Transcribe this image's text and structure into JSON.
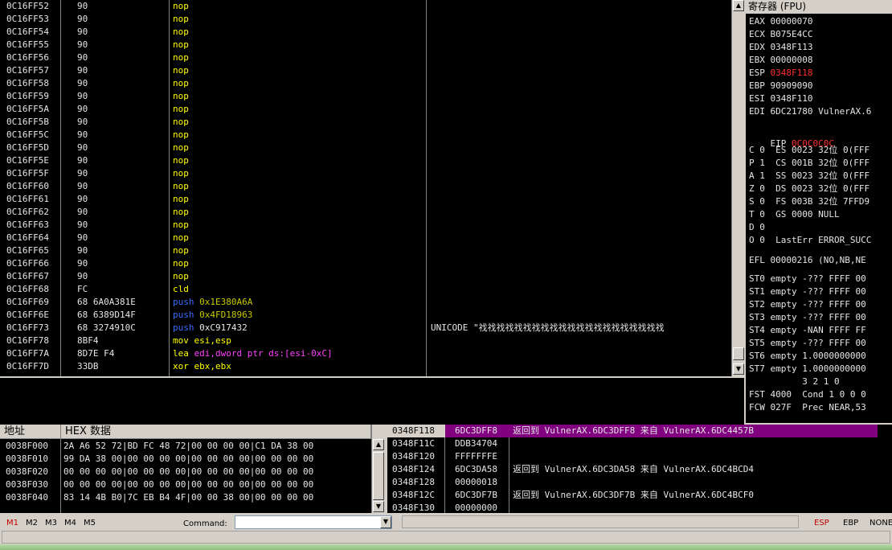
{
  "disasm": {
    "rows": [
      {
        "addr": "0C16FF52",
        "hex": "90",
        "mnem": "nop",
        "operand": "",
        "type": "nop"
      },
      {
        "addr": "0C16FF53",
        "hex": "90",
        "mnem": "nop",
        "operand": "",
        "type": "nop"
      },
      {
        "addr": "0C16FF54",
        "hex": "90",
        "mnem": "nop",
        "operand": "",
        "type": "nop"
      },
      {
        "addr": "0C16FF55",
        "hex": "90",
        "mnem": "nop",
        "operand": "",
        "type": "nop"
      },
      {
        "addr": "0C16FF56",
        "hex": "90",
        "mnem": "nop",
        "operand": "",
        "type": "nop"
      },
      {
        "addr": "0C16FF57",
        "hex": "90",
        "mnem": "nop",
        "operand": "",
        "type": "nop"
      },
      {
        "addr": "0C16FF58",
        "hex": "90",
        "mnem": "nop",
        "operand": "",
        "type": "nop"
      },
      {
        "addr": "0C16FF59",
        "hex": "90",
        "mnem": "nop",
        "operand": "",
        "type": "nop"
      },
      {
        "addr": "0C16FF5A",
        "hex": "90",
        "mnem": "nop",
        "operand": "",
        "type": "nop"
      },
      {
        "addr": "0C16FF5B",
        "hex": "90",
        "mnem": "nop",
        "operand": "",
        "type": "nop"
      },
      {
        "addr": "0C16FF5C",
        "hex": "90",
        "mnem": "nop",
        "operand": "",
        "type": "nop"
      },
      {
        "addr": "0C16FF5D",
        "hex": "90",
        "mnem": "nop",
        "operand": "",
        "type": "nop"
      },
      {
        "addr": "0C16FF5E",
        "hex": "90",
        "mnem": "nop",
        "operand": "",
        "type": "nop"
      },
      {
        "addr": "0C16FF5F",
        "hex": "90",
        "mnem": "nop",
        "operand": "",
        "type": "nop"
      },
      {
        "addr": "0C16FF60",
        "hex": "90",
        "mnem": "nop",
        "operand": "",
        "type": "nop"
      },
      {
        "addr": "0C16FF61",
        "hex": "90",
        "mnem": "nop",
        "operand": "",
        "type": "nop"
      },
      {
        "addr": "0C16FF62",
        "hex": "90",
        "mnem": "nop",
        "operand": "",
        "type": "nop"
      },
      {
        "addr": "0C16FF63",
        "hex": "90",
        "mnem": "nop",
        "operand": "",
        "type": "nop"
      },
      {
        "addr": "0C16FF64",
        "hex": "90",
        "mnem": "nop",
        "operand": "",
        "type": "nop"
      },
      {
        "addr": "0C16FF65",
        "hex": "90",
        "mnem": "nop",
        "operand": "",
        "type": "nop"
      },
      {
        "addr": "0C16FF66",
        "hex": "90",
        "mnem": "nop",
        "operand": "",
        "type": "nop"
      },
      {
        "addr": "0C16FF67",
        "hex": "90",
        "mnem": "nop",
        "operand": "",
        "type": "nop"
      },
      {
        "addr": "0C16FF68",
        "hex": "FC",
        "mnem": "cld",
        "operand": "",
        "type": "nop"
      },
      {
        "addr": "0C16FF69",
        "hex": "68 6A0A381E",
        "mnem": "push",
        "operand": "0x1E380A6A",
        "type": "push"
      },
      {
        "addr": "0C16FF6E",
        "hex": "68 6389D14F",
        "mnem": "push",
        "operand": "0x4FD18963",
        "type": "push"
      },
      {
        "addr": "0C16FF73",
        "hex": "68 3274910C",
        "mnem": "push",
        "operand": "0xC917432",
        "type": "push-w"
      },
      {
        "addr": "0C16FF78",
        "hex": "8BF4",
        "mnem": "mov",
        "operand": "esi,esp",
        "type": "reg"
      },
      {
        "addr": "0C16FF7A",
        "hex": "8D7E F4",
        "mnem": "lea",
        "operand": "edi,dword ptr ds:[esi-0xC]",
        "type": "lea"
      },
      {
        "addr": "0C16FF7D",
        "hex": "33DB",
        "mnem": "xor",
        "operand": "ebx,ebx",
        "type": "reg"
      }
    ],
    "comment": "UNICODE \"䄀䄀䄀䄀䄀䄀䄀䄀䄀䄀䄀䄀䄀䄀䄀䄀䄀䄀䄀䄀䄀"
  },
  "registers": {
    "title": "寄存器 (FPU)",
    "gp": [
      {
        "name": "EAX",
        "value": "00000070",
        "extra": "",
        "hl": false
      },
      {
        "name": "ECX",
        "value": "B075E4CC",
        "extra": "",
        "hl": false
      },
      {
        "name": "EDX",
        "value": "0348F113",
        "extra": "",
        "hl": false
      },
      {
        "name": "EBX",
        "value": "00000008",
        "extra": "",
        "hl": false
      },
      {
        "name": "ESP",
        "value": "0348F118",
        "extra": "",
        "hl": true
      },
      {
        "name": "EBP",
        "value": "90909090",
        "extra": "",
        "hl": false
      },
      {
        "name": "ESI",
        "value": "0348F110",
        "extra": "",
        "hl": false
      },
      {
        "name": "EDI",
        "value": "6DC21780",
        "extra": "VulnerAX.6",
        "hl": false
      }
    ],
    "eip": {
      "name": "EIP",
      "value": "0C0C0C0C"
    },
    "flags": [
      "C 0  ES 0023 32位 0(FFF",
      "P 1  CS 001B 32位 0(FFF",
      "A 1  SS 0023 32位 0(FFF",
      "Z 0  DS 0023 32位 0(FFF",
      "S 0  FS 003B 32位 7FFD9",
      "T 0  GS 0000 NULL",
      "D 0",
      "O 0  LastErr ERROR_SUCC"
    ],
    "efl": "EFL 00000216 (NO,NB,NE",
    "fpu": [
      "ST0 empty -??? FFFF 00",
      "ST1 empty -??? FFFF 00",
      "ST2 empty -??? FFFF 00",
      "ST3 empty -??? FFFF 00",
      "ST4 empty -NAN FFFF FF",
      "ST5 empty -??? FFFF 00",
      "ST6 empty 1.0000000000",
      "ST7 empty 1.0000000000"
    ],
    "fst_header": "          3 2 1 0",
    "fst": "FST 4000  Cond 1 0 0 0",
    "fcw": "FCW 027F  Prec NEAR,53"
  },
  "dump": {
    "header_addr": "地址",
    "header_hex": "HEX 数据",
    "rows": [
      {
        "addr": "0038F000",
        "hex": "2A A6 52 72|BD FC 48 72|00 00 00 00|C1 DA 38 00"
      },
      {
        "addr": "0038F010",
        "hex": "99 DA 38 00|00 00 00 00|00 00 00 00|00 00 00 00"
      },
      {
        "addr": "0038F020",
        "hex": "00 00 00 00|00 00 00 00|00 00 00 00|00 00 00 00"
      },
      {
        "addr": "0038F030",
        "hex": "00 00 00 00|00 00 00 00|00 00 00 00|00 00 00 00"
      },
      {
        "addr": "0038F040",
        "hex": "83 14 4B B0|7C EB B4 4F|00 00 38 00|00 00 00 00"
      }
    ]
  },
  "stack": {
    "rows": [
      {
        "addr": "0348F118",
        "value": "6DC3DFF8",
        "comment": "返回到 VulnerAX.6DC3DFF8 来自 VulnerAX.6DC4457B",
        "selected": true
      },
      {
        "addr": "0348F11C",
        "value": "DDB34704",
        "comment": "",
        "selected": false
      },
      {
        "addr": "0348F120",
        "value": "FFFFFFFE",
        "comment": "",
        "selected": false
      },
      {
        "addr": "0348F124",
        "value": "6DC3DA58",
        "comment": "返回到 VulnerAX.6DC3DA58 来自 VulnerAX.6DC4BCD4",
        "selected": false
      },
      {
        "addr": "0348F128",
        "value": "00000018",
        "comment": "",
        "selected": false
      },
      {
        "addr": "0348F12C",
        "value": "6DC3DF7B",
        "comment": "返回到 VulnerAX.6DC3DF7B 来自 VulnerAX.6DC4BCF0",
        "selected": false
      },
      {
        "addr": "0348F130",
        "value": "00000000",
        "comment": "",
        "selected": false
      }
    ]
  },
  "statusbar": {
    "m_buttons": [
      "M1",
      "M2",
      "M3",
      "M4",
      "M5"
    ],
    "command_label": "Command:",
    "command_value": "",
    "right_buttons": [
      "ESP",
      "EBP",
      "NONE"
    ]
  },
  "colors": {
    "selected_row": "#800080",
    "highlight_red": "#ff3030",
    "mnemonic_yellow": "#ffff00",
    "push_blue": "#3a6cff",
    "immediate_olive": "#c8c800"
  }
}
